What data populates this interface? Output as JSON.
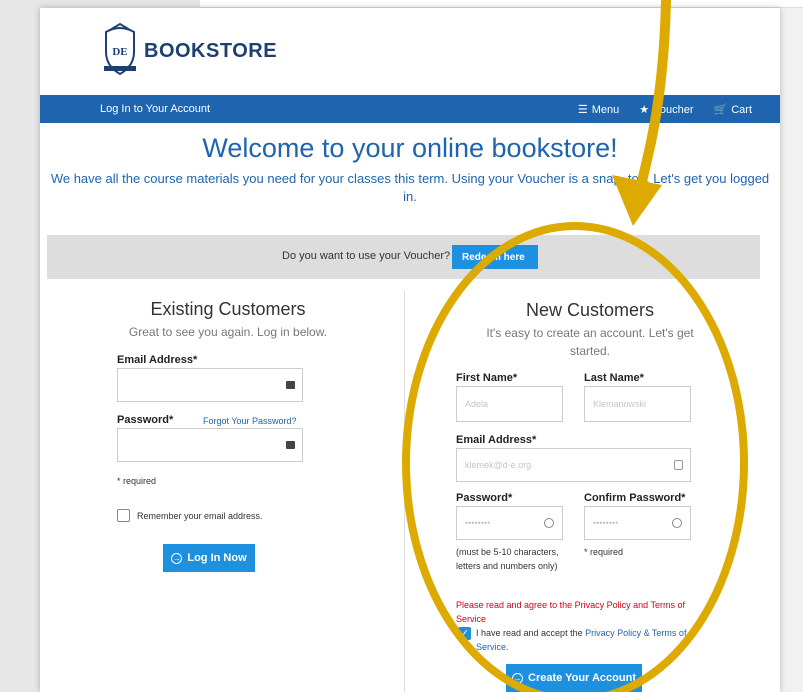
{
  "brand": {
    "name": "BOOKSTORE",
    "crest_letters": "DE"
  },
  "nav": {
    "login": "Log In to Your Account",
    "menu": "Menu",
    "voucher": "Voucher",
    "cart": "Cart"
  },
  "hero": {
    "title": "Welcome to your online bookstore!",
    "subtitle": "We have all the course materials you need for your classes this term. Using your Voucher is a snap, too. Let's get you logged in."
  },
  "voucher_bar": {
    "question": "Do you want to use your Voucher?",
    "button": "Redeem here"
  },
  "existing": {
    "title": "Existing Customers",
    "subtitle": "Great to see you again. Log in below.",
    "email_label": "Email Address*",
    "password_label": "Password*",
    "forgot": "Forgot Your Password?",
    "required": "* required",
    "remember": "Remember your email address.",
    "login_button": "Log In Now"
  },
  "new": {
    "title": "New Customers",
    "subtitle": "It's easy to create an account. Let's get started.",
    "first_label": "First Name*",
    "first_value": "Adela",
    "last_label": "Last Name*",
    "last_value": "Klemanowski",
    "email_label": "Email Address*",
    "email_value": "klemek@d-e.org",
    "password_label": "Password*",
    "password_value": "••••••••",
    "confirm_label": "Confirm Password*",
    "confirm_value": "••••••••",
    "password_hint": "(must be 5-10 characters, letters and numbers only)",
    "required": "* required",
    "warning": "Please read and agree to the Privacy Policy and Terms of Service",
    "accept_prefix": "I have read and accept the ",
    "accept_link": "Privacy Policy & Terms of Service",
    "accept_suffix": ".",
    "create_button": "Create Your Account"
  },
  "colors": {
    "brand_blue": "#1e64ae",
    "button_blue": "#1e90e0",
    "annotation_gold": "#dcaa00",
    "warning_red": "#d0021b"
  }
}
